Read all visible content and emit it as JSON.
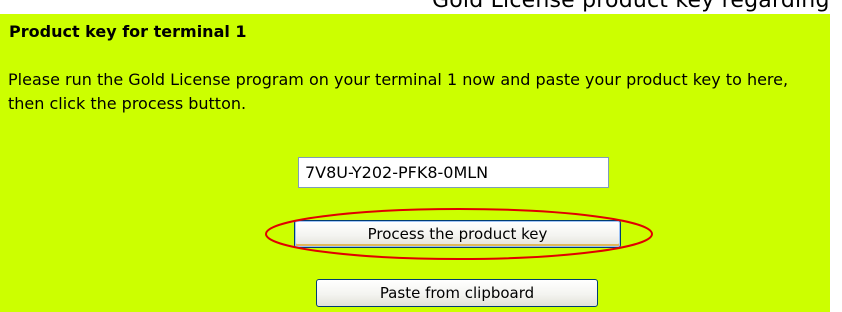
{
  "page": {
    "top_fragment": "Gold License product key regarding"
  },
  "panel": {
    "heading": "Product key for terminal 1",
    "instructions": "Please run the Gold License program on your terminal 1 now and paste your product key to here, then click the process button."
  },
  "form": {
    "product_key_value": "7V8U-Y202-PFK8-0MLN",
    "process_button_label": "Process the product key",
    "paste_button_label": "Paste from clipboard"
  },
  "colors": {
    "panel_background": "#ccff00",
    "highlight_ellipse": "#e00000"
  }
}
